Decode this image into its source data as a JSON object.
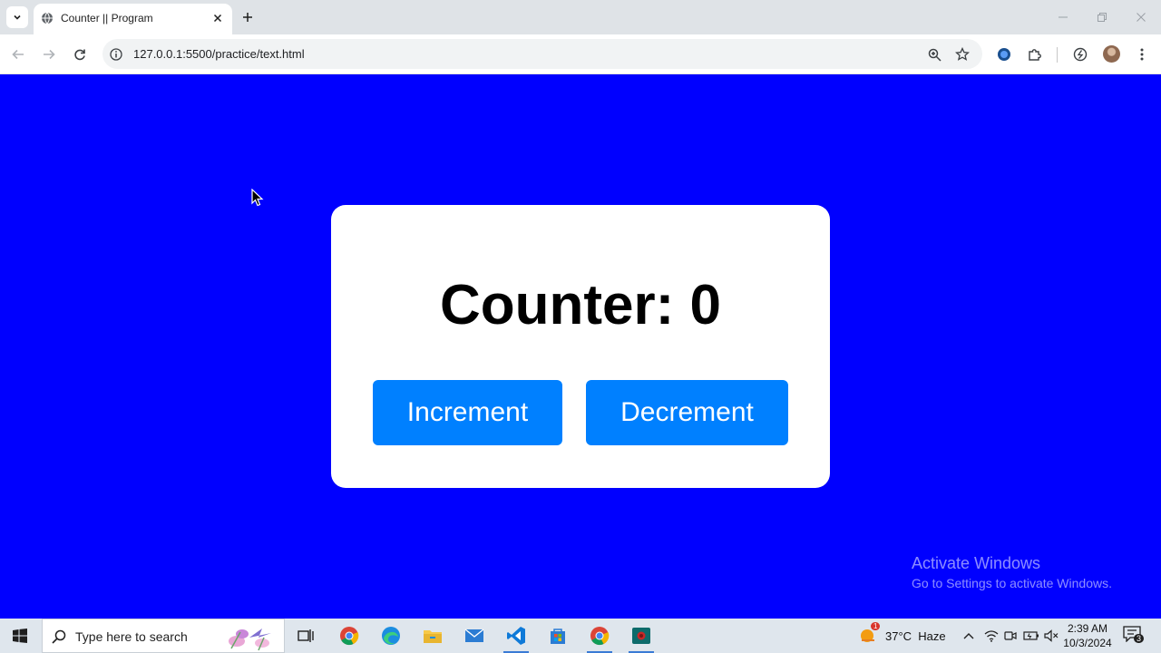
{
  "browser": {
    "tab_title": "Counter || Program",
    "url": "127.0.0.1:5500/practice/text.html"
  },
  "page": {
    "background_color": "#0000ff",
    "counter_text": "Counter: 0",
    "increment_label": "Increment",
    "decrement_label": "Decrement",
    "button_color": "#0080ff"
  },
  "watermark": {
    "line1": "Activate Windows",
    "line2": "Go to Settings to activate Windows."
  },
  "taskbar": {
    "search_placeholder": "Type here to search",
    "weather": "37°C  Haze",
    "weather_alert": "1",
    "time": "2:39 AM",
    "date": "10/3/2024",
    "notifications": "3",
    "apps": [
      "task-view",
      "chrome",
      "edge",
      "file-explorer",
      "mail",
      "vscode",
      "microsoft-store",
      "chrome",
      "screen-recorder"
    ]
  }
}
